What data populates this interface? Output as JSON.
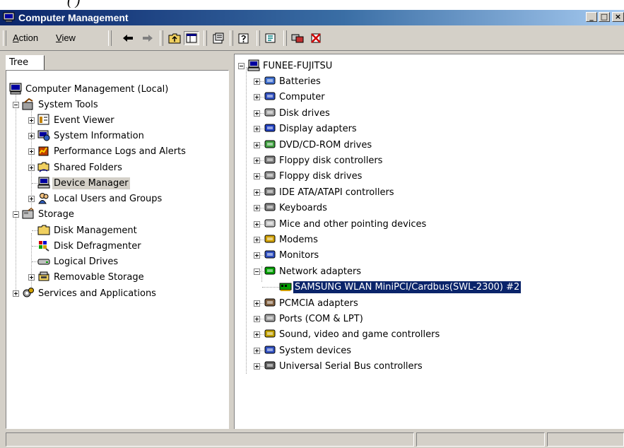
{
  "caption_fragment": "(                                                    )",
  "window": {
    "title": "Computer Management",
    "controls": {
      "minimize": "_",
      "maximize": "□",
      "close": "×"
    }
  },
  "menu": {
    "action": {
      "accel": "A",
      "rest": "ction"
    },
    "view": {
      "accel": "V",
      "rest": "iew"
    }
  },
  "toolbar_icons": [
    "back-arrow-icon",
    "forward-arrow-icon",
    "up-folder-icon",
    "show-hide-tree-icon",
    "properties-icon",
    "help-icon",
    "export-list-icon",
    "connect-icon",
    "disconnect-icon"
  ],
  "tab_label": "Tree",
  "tree": {
    "root": "Computer Management (Local)",
    "system_tools": "System Tools",
    "event_viewer": "Event Viewer",
    "system_information": "System Information",
    "perf_logs": "Performance Logs and Alerts",
    "shared_folders": "Shared Folders",
    "device_manager": "Device Manager",
    "local_users": "Local Users and Groups",
    "storage": "Storage",
    "disk_management": "Disk Management",
    "disk_defrag": "Disk Defragmenter",
    "logical_drives": "Logical Drives",
    "removable_storage": "Removable Storage",
    "services_apps": "Services and Applications",
    "selected": "Device Manager"
  },
  "devices": {
    "computer_name": "FUNEE-FUJITSU",
    "categories": [
      "Batteries",
      "Computer",
      "Disk drives",
      "Display adapters",
      "DVD/CD-ROM drives",
      "Floppy disk controllers",
      "Floppy disk drives",
      "IDE ATA/ATAPI controllers",
      "Keyboards",
      "Mice and other pointing devices",
      "Modems",
      "Monitors",
      "Network adapters",
      "PCMCIA adapters",
      "Ports (COM & LPT)",
      "Sound, video and game controllers",
      "System devices",
      "Universal Serial Bus controllers"
    ],
    "expanded_category": "Network adapters",
    "network_device": "SAMSUNG WLAN MiniPCI/Cardbus(SWL-2300) #2",
    "selected": "SAMSUNG WLAN MiniPCI/Cardbus(SWL-2300) #2"
  },
  "colors": {
    "title_bar_start": "#0a246a",
    "title_bar_end": "#a6caf0",
    "selection_blue": "#0a246a",
    "window_face": "#d4d0c8"
  }
}
